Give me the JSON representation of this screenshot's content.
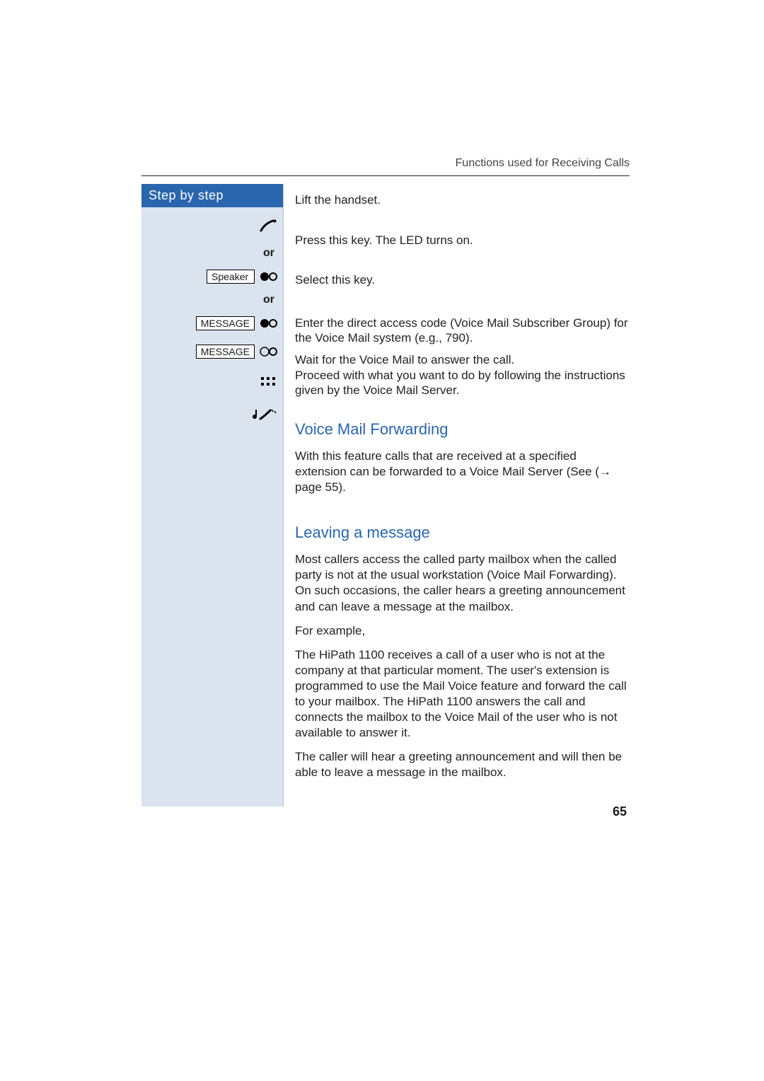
{
  "running_head": "Functions used for Receiving Calls",
  "sidebar": {
    "title": "Step by step",
    "or_label": "or",
    "keys": {
      "speaker": "Speaker",
      "message": "MESSAGE"
    }
  },
  "steps": {
    "lift": "Lift the handset.",
    "press_speaker": "Press this key. The LED turns on.",
    "select_message": "Select this key.",
    "dial_code": "Enter the direct access code (Voice Mail Subscriber Group) for the Voice Mail system (e.g., 790).",
    "wait": "Wait for the Voice Mail to answer the call.\nProceed with what you want to do by following the instructions given by the Voice Mail Server."
  },
  "sections": {
    "forwarding": {
      "title": "Voice Mail Forwarding",
      "p1": "With this feature calls that are received at a specified extension can be forwarded to a Voice Mail Server (See (→ page 55)."
    },
    "leaving": {
      "title": "Leaving a message",
      "p1": "Most callers access the called party mailbox when the called party is not at the usual workstation (Voice Mail Forwarding). On such occasions, the caller hears a greeting announcement and can leave a message at the mailbox.",
      "p2": "For example,",
      "p3": "The HiPath 1100 receives a call of a user who is not at the company at that particular moment. The user's extension is programmed to use the Mail Voice feature and forward the call to your mailbox. The HiPath 1100 answers the call and connects the mailbox to the Voice Mail of the user who is not available to answer it.",
      "p4": "The caller will hear a greeting announcement and will then be able to leave a message in the mailbox."
    }
  },
  "page_number": "65"
}
